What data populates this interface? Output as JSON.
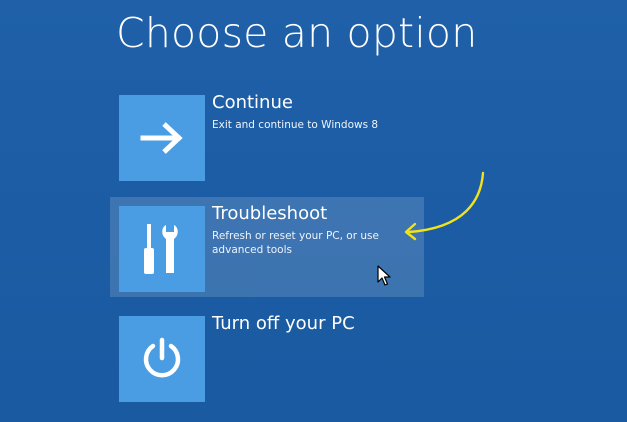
{
  "page": {
    "title": "Choose an option",
    "background_color": "#1d5ea7",
    "tile_color": "#4a9de2",
    "annotation_color": "#f2e21a"
  },
  "options": [
    {
      "id": "continue",
      "title": "Continue",
      "description": "Exit and continue to Windows 8",
      "icon": "arrow-right-icon"
    },
    {
      "id": "troubleshoot",
      "title": "Troubleshoot",
      "description": "Refresh or reset your PC, or use advanced tools",
      "icon": "tools-icon",
      "highlighted": true
    },
    {
      "id": "turnoff",
      "title": "Turn off your PC",
      "description": "",
      "icon": "power-icon"
    }
  ]
}
